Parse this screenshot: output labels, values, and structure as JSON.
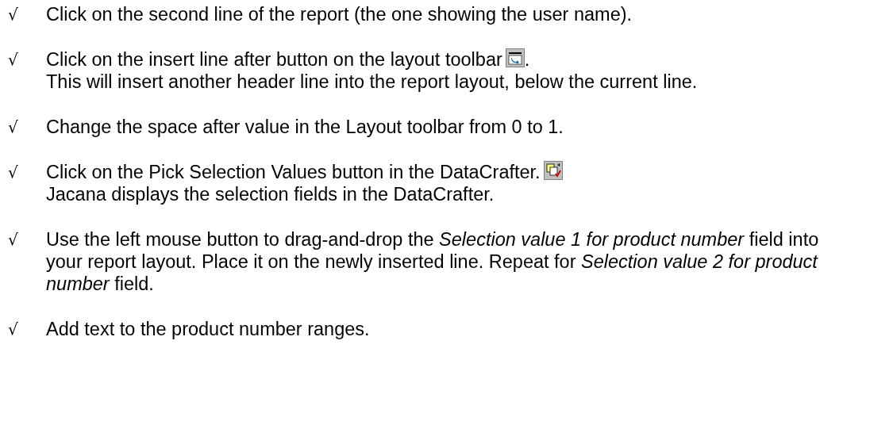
{
  "steps": [
    {
      "mark": "√",
      "text": "Click on the second line of the report (the one showing the user name)."
    },
    {
      "mark": "√",
      "text": "Click on the insert line after button on the layout toolbar",
      "kind": "insert_line",
      "suffix": ".",
      "note": "This will insert another header line into the report layout, below the current line."
    },
    {
      "mark": "√",
      "text": "Change the space after value in the Layout toolbar from 0 to 1."
    },
    {
      "mark": "√",
      "text": "Click on the Pick Selection Values button in the DataCrafter.",
      "kind": "pick_values",
      "note": "Jacana displays the selection fields in the DataCrafter."
    },
    {
      "mark": "√",
      "text": "Use the left mouse button to drag-and-drop the *Selection value 1 for product number* field into your report layout. Place it on the newly inserted line. Repeat for *Selection value 2 for product number* field."
    },
    {
      "mark": "√",
      "text": "Add text to the product number ranges."
    }
  ]
}
